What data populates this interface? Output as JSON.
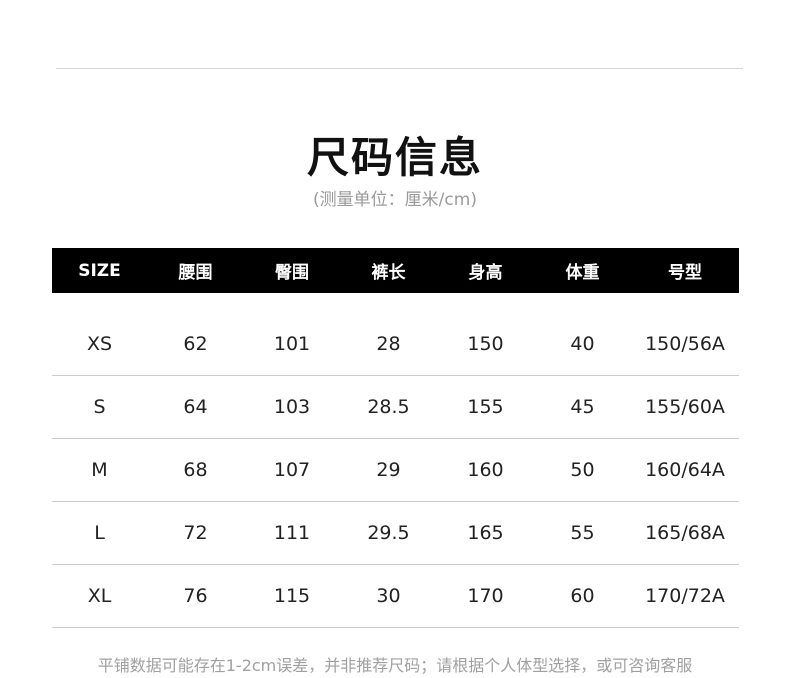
{
  "title": "尺码信息",
  "subtitle": "(测量单位：厘米/cm)",
  "table": {
    "headers": [
      "SIZE",
      "腰围",
      "臀围",
      "裤长",
      "身高",
      "体重",
      "号型"
    ],
    "rows": [
      [
        "XS",
        "62",
        "101",
        "28",
        "150",
        "40",
        "150/56A"
      ],
      [
        "S",
        "64",
        "103",
        "28.5",
        "155",
        "45",
        "155/60A"
      ],
      [
        "M",
        "68",
        "107",
        "29",
        "160",
        "50",
        "160/64A"
      ],
      [
        "L",
        "72",
        "111",
        "29.5",
        "165",
        "55",
        "165/68A"
      ],
      [
        "XL",
        "76",
        "115",
        "30",
        "170",
        "60",
        "170/72A"
      ]
    ]
  },
  "footnote": "平铺数据可能存在1-2cm误差，并非推荐尺码；请根据个人体型选择，或可咨询客服"
}
